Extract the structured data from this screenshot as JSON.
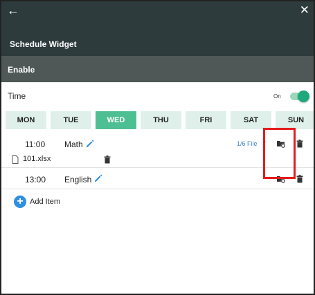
{
  "header": {
    "back_icon": "arrow-left-icon",
    "close_icon": "close-icon",
    "title": "Schedule Widget"
  },
  "enable": {
    "label": "Enable"
  },
  "time": {
    "label": "Time",
    "toggle_state": "On",
    "toggle_on": true
  },
  "days": [
    {
      "label": "MON",
      "active": false
    },
    {
      "label": "TUE",
      "active": false
    },
    {
      "label": "WED",
      "active": true
    },
    {
      "label": "THU",
      "active": false
    },
    {
      "label": "FRI",
      "active": false
    },
    {
      "label": "SAT",
      "active": false
    },
    {
      "label": "SUN",
      "active": false
    }
  ],
  "items": [
    {
      "time": "11:00",
      "subject": "Math",
      "file_count": "1/6 File",
      "files": [
        {
          "name": "101.xlsx"
        }
      ]
    },
    {
      "time": "13:00",
      "subject": "English"
    }
  ],
  "add_item": {
    "label": "Add Item"
  },
  "colors": {
    "header_bg": "#2e3b3d",
    "enable_bg": "#505757",
    "accent": "#4ebf92",
    "day_bg": "#dff0eb",
    "link": "#3f86c9",
    "highlight": "#e51c1c"
  }
}
